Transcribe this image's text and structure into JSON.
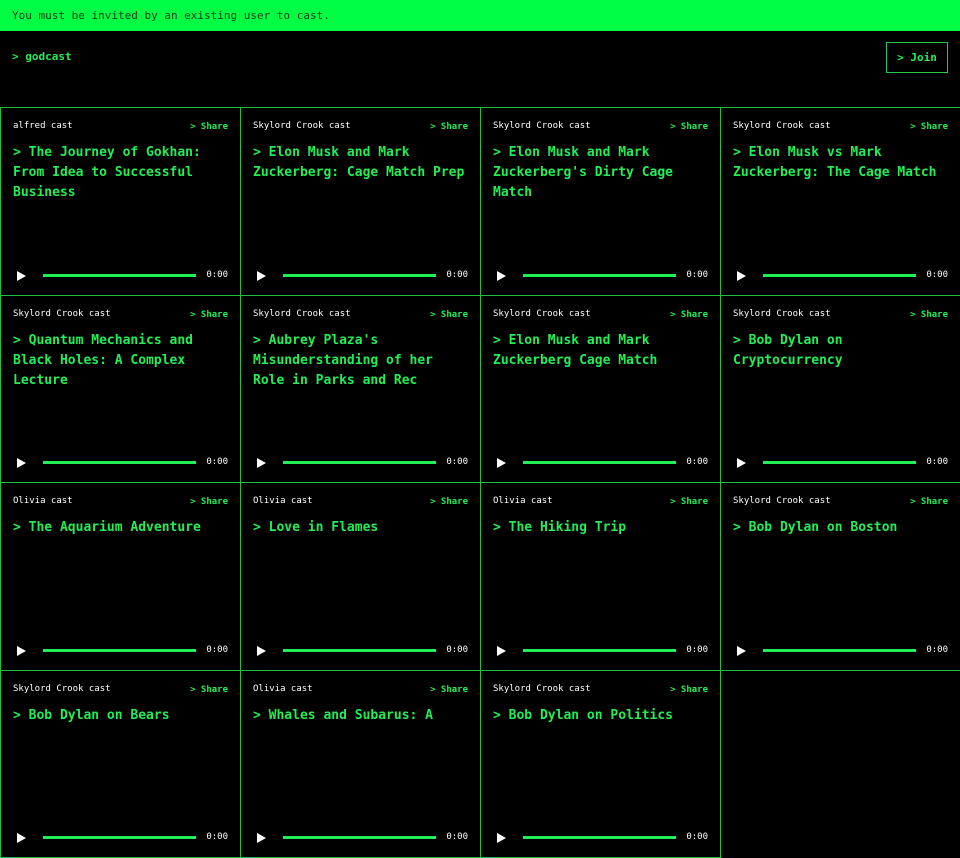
{
  "banner": {
    "text": "You must be invited by an existing user to cast."
  },
  "header": {
    "brand": "> godcast",
    "join_label": "> Join"
  },
  "share_label": "> Share",
  "casts": [
    {
      "author": "alfred cast",
      "title": "> The Journey of Gokhan: From Idea to Successful Business",
      "time": "0:00"
    },
    {
      "author": "Skylord Crook cast",
      "title": "> Elon Musk and Mark Zuckerberg: Cage Match Prep",
      "time": "0:00"
    },
    {
      "author": "Skylord Crook cast",
      "title": "> Elon Musk and Mark Zuckerberg's Dirty Cage Match",
      "time": "0:00"
    },
    {
      "author": "Skylord Crook cast",
      "title": "> Elon Musk vs Mark Zuckerberg: The Cage Match",
      "time": "0:00"
    },
    {
      "author": "Skylord Crook cast",
      "title": "> Quantum Mechanics and Black Holes: A Complex Lecture",
      "time": "0:00"
    },
    {
      "author": "Skylord Crook cast",
      "title": "> Aubrey Plaza's Misunderstanding of her Role in Parks and Rec",
      "time": "0:00"
    },
    {
      "author": "Skylord Crook cast",
      "title": "> Elon Musk and Mark Zuckerberg Cage Match",
      "time": "0:00"
    },
    {
      "author": "Skylord Crook cast",
      "title": "> Bob Dylan on Cryptocurrency",
      "time": "0:00"
    },
    {
      "author": "Olivia cast",
      "title": "> The Aquarium Adventure",
      "time": "0:00"
    },
    {
      "author": "Olivia cast",
      "title": "> Love in Flames",
      "time": "0:00"
    },
    {
      "author": "Olivia cast",
      "title": "> The Hiking Trip",
      "time": "0:00"
    },
    {
      "author": "Skylord Crook cast",
      "title": "> Bob Dylan on Boston",
      "time": "0:00"
    },
    {
      "author": "Skylord Crook cast",
      "title": "> Bob Dylan on Bears",
      "time": "0:00"
    },
    {
      "author": "Olivia cast",
      "title": "> Whales and Subarus: A",
      "time": "0:00"
    },
    {
      "author": "Skylord Crook cast",
      "title": "> Bob Dylan on Politics",
      "time": "0:00"
    }
  ]
}
